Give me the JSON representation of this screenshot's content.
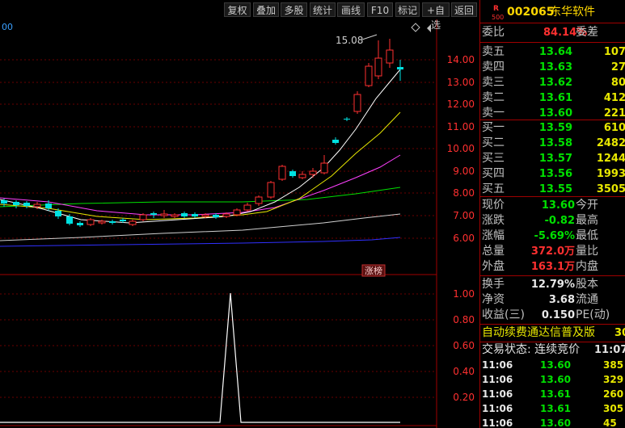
{
  "toolbar": {
    "buttons": [
      "复权",
      "叠加",
      "多股",
      "统计",
      "画线",
      "F10",
      "标记",
      "+自选",
      "返回"
    ]
  },
  "chart": {
    "left_label": "00",
    "price_axis": [
      "14.00",
      "13.00",
      "12.00",
      "11.00",
      "10.00",
      "9.00",
      "8.00",
      "7.00",
      "6.00"
    ],
    "peak_label": "15.08",
    "badge": "涨榜",
    "indicator_axis": [
      "1.00",
      "0.80",
      "0.60",
      "0.40",
      "0.20"
    ]
  },
  "quote": {
    "r_label": "R",
    "r_num": "500",
    "code": "002065",
    "name": "东华软件",
    "ratio_label": "委比",
    "ratio_value": "84.14%",
    "diff_label": "委差",
    "sell": [
      {
        "label": "卖五",
        "price": "13.64",
        "vol": "107"
      },
      {
        "label": "卖四",
        "price": "13.63",
        "vol": "27"
      },
      {
        "label": "卖三",
        "price": "13.62",
        "vol": "80"
      },
      {
        "label": "卖二",
        "price": "13.61",
        "vol": "412"
      },
      {
        "label": "卖一",
        "price": "13.60",
        "vol": "221"
      }
    ],
    "buy": [
      {
        "label": "买一",
        "price": "13.59",
        "vol": "610"
      },
      {
        "label": "买二",
        "price": "13.58",
        "vol": "2482"
      },
      {
        "label": "买三",
        "price": "13.57",
        "vol": "1244"
      },
      {
        "label": "买四",
        "price": "13.56",
        "vol": "1993"
      },
      {
        "label": "买五",
        "price": "13.55",
        "vol": "3505"
      }
    ],
    "stats": [
      {
        "l1": "现价",
        "v1": "13.60",
        "l2": "今开"
      },
      {
        "l1": "涨跌",
        "v1": "-0.82",
        "l2": "最高"
      },
      {
        "l1": "涨幅",
        "v1": "-5.69%",
        "l2": "最低"
      },
      {
        "l1": "总量",
        "v1": "372.0万",
        "l2": "量比"
      },
      {
        "l1": "外盘",
        "v1": "163.1万",
        "l2": "内盘"
      }
    ],
    "stats2": [
      {
        "l1": "换手",
        "v1": "12.79%",
        "l2": "股本"
      },
      {
        "l1": "净资",
        "v1": "3.68",
        "l2": "流通"
      },
      {
        "l1": "收益(三)",
        "v1": "0.150",
        "l2": "PE(动)"
      }
    ],
    "ad_text": "自动续费通达信普及版",
    "ad_num": "30",
    "trade_status": "交易状态: 连续竞价",
    "trade_time": "11:07:",
    "ticks": [
      {
        "time": "11:06",
        "price": "13.60",
        "vol": "385"
      },
      {
        "time": "11:06",
        "price": "13.60",
        "vol": "329"
      },
      {
        "time": "11:06",
        "price": "13.61",
        "vol": "260"
      },
      {
        "time": "11:06",
        "price": "13.61",
        "vol": "305"
      },
      {
        "time": "11:06",
        "price": "13.60",
        "vol": "45"
      }
    ]
  },
  "colors": {
    "up": "#ff3030",
    "down": "#00e0e0",
    "border": "#a00000",
    "ma5": "#ffffff",
    "ma10": "#e8e800",
    "ma20": "#ff40ff",
    "ma60": "#00e000",
    "ma120": "#d0d0d0",
    "ma250": "#3030ff"
  }
}
